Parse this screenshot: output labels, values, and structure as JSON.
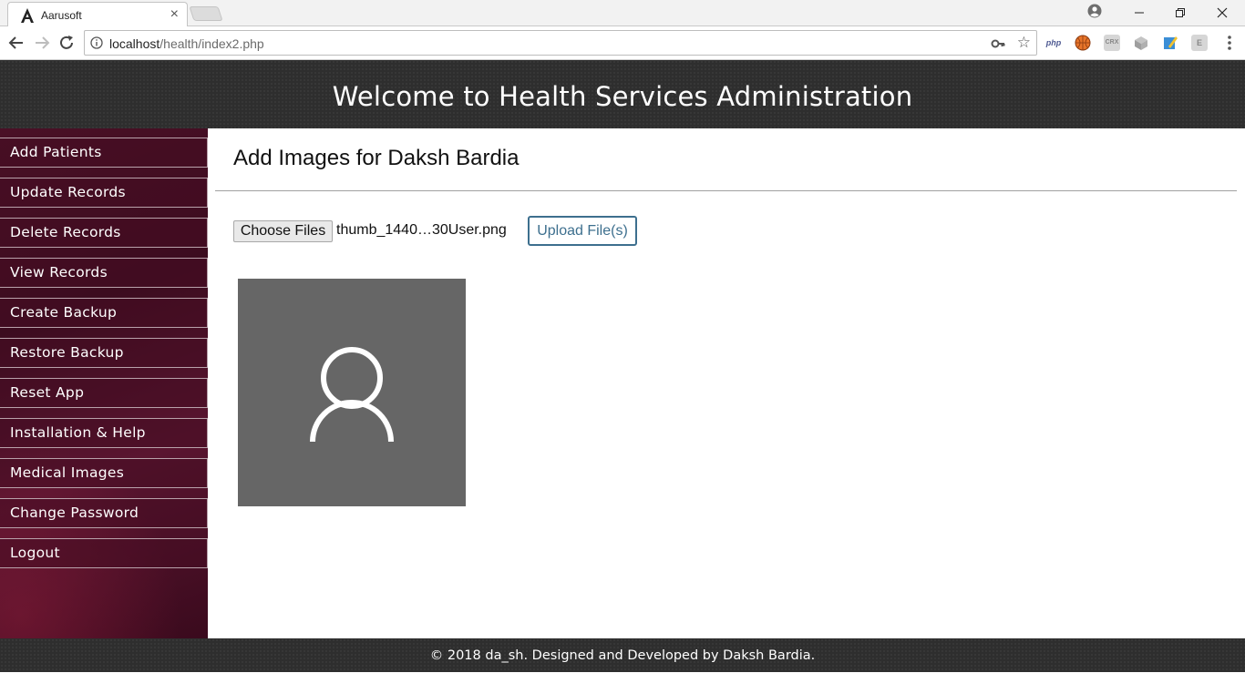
{
  "browser": {
    "tab_title": "Aarusoft",
    "tab_close": "×",
    "url_host": "localhost",
    "url_path": "/health/index2.php",
    "extensions": [
      {
        "name": "php-icon",
        "label": "php",
        "color": "#4f5b93"
      },
      {
        "name": "basketball-icon",
        "label": "",
        "color": "#e8752a"
      },
      {
        "name": "crx-icon",
        "label": "CRX",
        "color": "#9e9e9e"
      },
      {
        "name": "cube-icon",
        "label": "",
        "color": "#9e9e9e"
      },
      {
        "name": "edit-icon",
        "label": "",
        "color": "#3b8ed6"
      },
      {
        "name": "e-icon",
        "label": "E",
        "color": "#9e9e9e"
      }
    ]
  },
  "header": {
    "title": "Welcome to Health Services Administration"
  },
  "sidebar": {
    "items": [
      {
        "label": "Add Patients"
      },
      {
        "label": "Update Records"
      },
      {
        "label": "Delete Records"
      },
      {
        "label": "View Records"
      },
      {
        "label": "Create Backup"
      },
      {
        "label": "Restore Backup"
      },
      {
        "label": "Reset App"
      },
      {
        "label": "Installation & Help"
      },
      {
        "label": "Medical Images"
      },
      {
        "label": "Change Password"
      },
      {
        "label": "Logout"
      }
    ]
  },
  "main": {
    "title": "Add Images for Daksh Bardia",
    "choose_label": "Choose Files",
    "file_name": "thumb_1440…30User.png",
    "upload_label": "Upload File(s)"
  },
  "footer": {
    "text": "© 2018 da_sh. Designed and Developed by Daksh Bardia."
  },
  "colors": {
    "header_bg": "#2e2e2e",
    "sidebar_bg": "#4a1026",
    "upload_accent": "#3d6f8e",
    "thumb_bg": "#666666"
  }
}
